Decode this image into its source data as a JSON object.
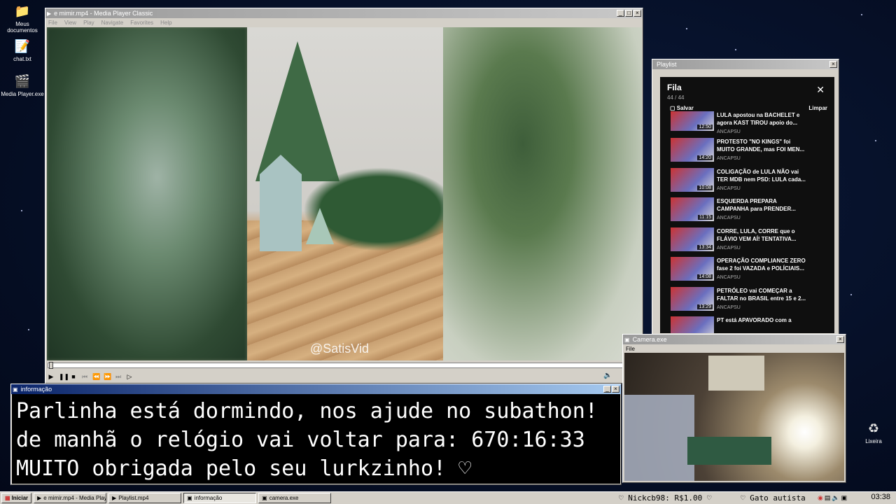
{
  "desktop": {
    "icons": [
      "Meus documentos",
      "chat.txt",
      "Media Player.exe"
    ],
    "recycle_bin": "Lixeira"
  },
  "media_player": {
    "title": "e mimir.mp4 - Media Player Classic",
    "menu": [
      "File",
      "View",
      "Play",
      "Navigate",
      "Favorites",
      "Help"
    ],
    "watermark": "@SatisVid"
  },
  "playlist": {
    "window_title": "Playlist",
    "heading": "Fila",
    "count": "44 / 44",
    "save_label": "Salvar",
    "clear_label": "Limpar",
    "items": [
      {
        "title1": "LULA apostou na BACHELET e",
        "title2": "agora KAST TIROU apoio do...",
        "channel": "ANCAPSU",
        "duration": "12:50"
      },
      {
        "title1": "PROTESTO \"NO KINGS\" foi",
        "title2": "MUITO GRANDE, mas FOI MEN...",
        "channel": "ANCAPSU",
        "duration": "14:20"
      },
      {
        "title1": "COLIGAÇÃO de LULA NÃO vai",
        "title2": "TER MDB nem PSD: LULA cada...",
        "channel": "ANCAPSU",
        "duration": "10:08"
      },
      {
        "title1": "ESQUERDA PREPARA",
        "title2": "CAMPANHA para PRENDER...",
        "channel": "ANCAPSU",
        "duration": "11:15"
      },
      {
        "title1": "CORRE, LULA, CORRE que o",
        "title2": "FLÁVIO VEM AÍ! TENTATIVA...",
        "channel": "ANCAPSU",
        "duration": "13:34"
      },
      {
        "title1": "OPERAÇÃO COMPLIANCE ZERO",
        "title2": "fase 2 foi VAZADA e POLÍCIAIS...",
        "channel": "ANCAPSU",
        "duration": "14:08"
      },
      {
        "title1": "PETRÓLEO vai COMEÇAR a",
        "title2": "FALTAR no BRASIL entre 15 e 2...",
        "channel": "ANCAPSU",
        "duration": "13:29"
      },
      {
        "title1": "PT está APAVORADO com a",
        "title2": "",
        "channel": "",
        "duration": ""
      }
    ]
  },
  "info_window": {
    "title": "informação",
    "lines": [
      "Parlinha está dormindo, nos ajude no subathon!",
      "de manhã o relógio vai voltar para:  670:16:33",
      "MUITO obrigada pelo seu lurkzinho! ♡"
    ]
  },
  "camera_window": {
    "title": "Camera.exe",
    "menu": "File"
  },
  "taskbar": {
    "start": "Iniciar",
    "tasks": [
      "e mimir.mp4 - Media Playe...",
      "Playlist.mp4",
      "informação",
      "camera.exe"
    ],
    "ticker_left": "♡ Nickcb98: R$1.00 ♡",
    "ticker_right": "♡ Gato autista",
    "clock": "03:38"
  }
}
